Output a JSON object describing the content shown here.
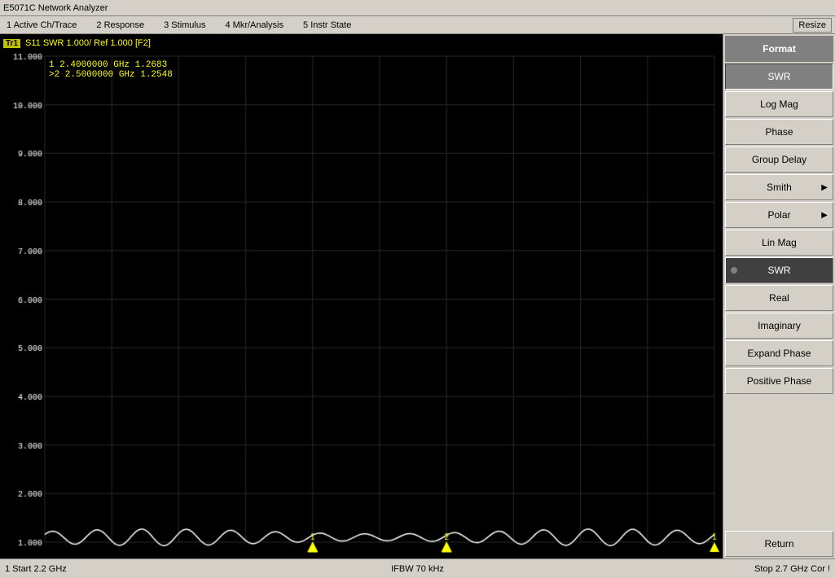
{
  "titleBar": {
    "title": "E5071C Network Analyzer"
  },
  "menuBar": {
    "items": [
      {
        "label": "1 Active Ch/Trace",
        "id": "active-ch"
      },
      {
        "label": "2 Response",
        "id": "response"
      },
      {
        "label": "3 Stimulus",
        "id": "stimulus"
      },
      {
        "label": "4 Mkr/Analysis",
        "id": "mkr-analysis"
      },
      {
        "label": "5 Instr State",
        "id": "instr-state"
      }
    ],
    "resizeLabel": "Resize"
  },
  "traceHeader": {
    "traceLabel": "Tr1",
    "traceInfo": "S11  SWR  1.000/  Ref  1.000  [F2]"
  },
  "markerReadout": {
    "marker1": "  1   2.4000000  GHz    1.2683",
    "marker2": " >2   2.5000000  GHz    1.2548"
  },
  "yAxis": {
    "labels": [
      {
        "value": "11.00",
        "pct": 2
      },
      {
        "value": "10.00",
        "pct": 12
      },
      {
        "value": "9.000",
        "pct": 22
      },
      {
        "value": "8.000",
        "pct": 32
      },
      {
        "value": "7.000",
        "pct": 42
      },
      {
        "value": "6.000",
        "pct": 52
      },
      {
        "value": "5.000",
        "pct": 62
      },
      {
        "value": "4.000",
        "pct": 72
      },
      {
        "value": "3.000",
        "pct": 82
      },
      {
        "value": "2.000",
        "pct": 88
      },
      {
        "value": "1.000",
        "pct": 97
      }
    ]
  },
  "statusBar": {
    "left": "1  Start 2.2 GHz",
    "center": "IFBW 70 kHz",
    "right": "Stop 2.7 GHz  Cor  !"
  },
  "rightPanel": {
    "buttons": [
      {
        "label": "Format",
        "id": "format-header",
        "isHeader": true
      },
      {
        "label": "SWR",
        "id": "swr-format",
        "isActive": true
      },
      {
        "label": "Log Mag",
        "id": "log-mag"
      },
      {
        "label": "Phase",
        "id": "phase"
      },
      {
        "label": "Group Delay",
        "id": "group-delay"
      },
      {
        "label": "Smith",
        "id": "smith",
        "hasArrow": true
      },
      {
        "label": "Polar",
        "id": "polar",
        "hasArrow": true
      },
      {
        "label": "Lin Mag",
        "id": "lin-mag"
      },
      {
        "label": "SWR",
        "id": "swr-selected",
        "isSelectedFormat": true,
        "hasDot": true
      },
      {
        "label": "Real",
        "id": "real"
      },
      {
        "label": "Imaginary",
        "id": "imaginary"
      },
      {
        "label": "Expand Phase",
        "id": "expand-phase"
      },
      {
        "label": "Positive Phase",
        "id": "positive-phase"
      },
      {
        "label": "Return",
        "id": "return-btn"
      }
    ]
  },
  "chart": {
    "backgroundColor": "#000000",
    "gridColor": "#333333",
    "traceColor": "#ffffff",
    "marker1Color": "#ffff00",
    "marker2Color": "#ffff00"
  }
}
